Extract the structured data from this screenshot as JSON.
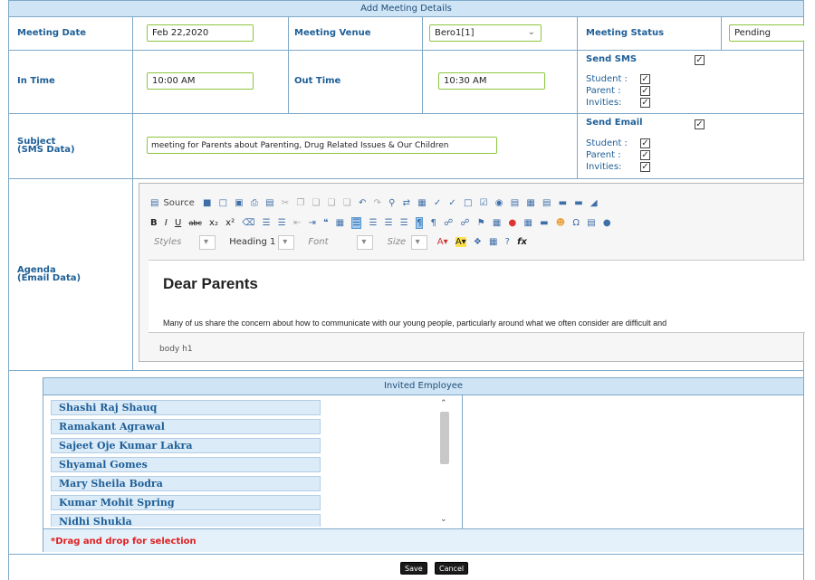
{
  "header": {
    "title": "Add Meeting Details"
  },
  "row1": {
    "date_label": "Meeting Date",
    "date_value": "Feb 22,2020",
    "venue_label": "Meeting Venue",
    "venue_value": "Bero1[1]",
    "status_label": "Meeting Status",
    "status_value": "Pending"
  },
  "row2": {
    "in_label": "In Time",
    "in_value": "10:00 AM",
    "out_label": "Out Time",
    "out_value": "10:30 AM",
    "sms": {
      "label": "Send SMS",
      "student": "Student :",
      "parent": "Parent :",
      "invities": "Invities:"
    }
  },
  "row3": {
    "subject_label": "Subject",
    "subject_sub": "(SMS Data)",
    "subject_value": "meeting for Parents about Parenting, Drug Related Issues & Our Children",
    "email": {
      "label": "Send Email",
      "student": "Student :",
      "parent": "Parent :",
      "invities": "Invities:"
    }
  },
  "agenda": {
    "label": "Agenda",
    "sub": "(Email Data)",
    "toolbar": {
      "source": "Source",
      "styles": "Styles",
      "format": "Heading 1",
      "font": "Font",
      "size": "Size"
    },
    "heading": "Dear Parents",
    "paragraph": "Many of us share the concern about how to communicate with our young people, particularly around what we often consider are difficult and",
    "path": "body  h1"
  },
  "invited": {
    "title": "Invited Employee",
    "employees": [
      "Shashi Raj Shauq",
      "Ramakant Agrawal",
      "Sajeet Oje Kumar Lakra",
      "Shyamal Gomes",
      "Mary Sheila Bodra",
      "Kumar Mohit Spring",
      "Nidhi Shukla"
    ],
    "hint": "*Drag and drop for selection"
  },
  "actions": {
    "save": "Save",
    "cancel": "Cancel"
  }
}
